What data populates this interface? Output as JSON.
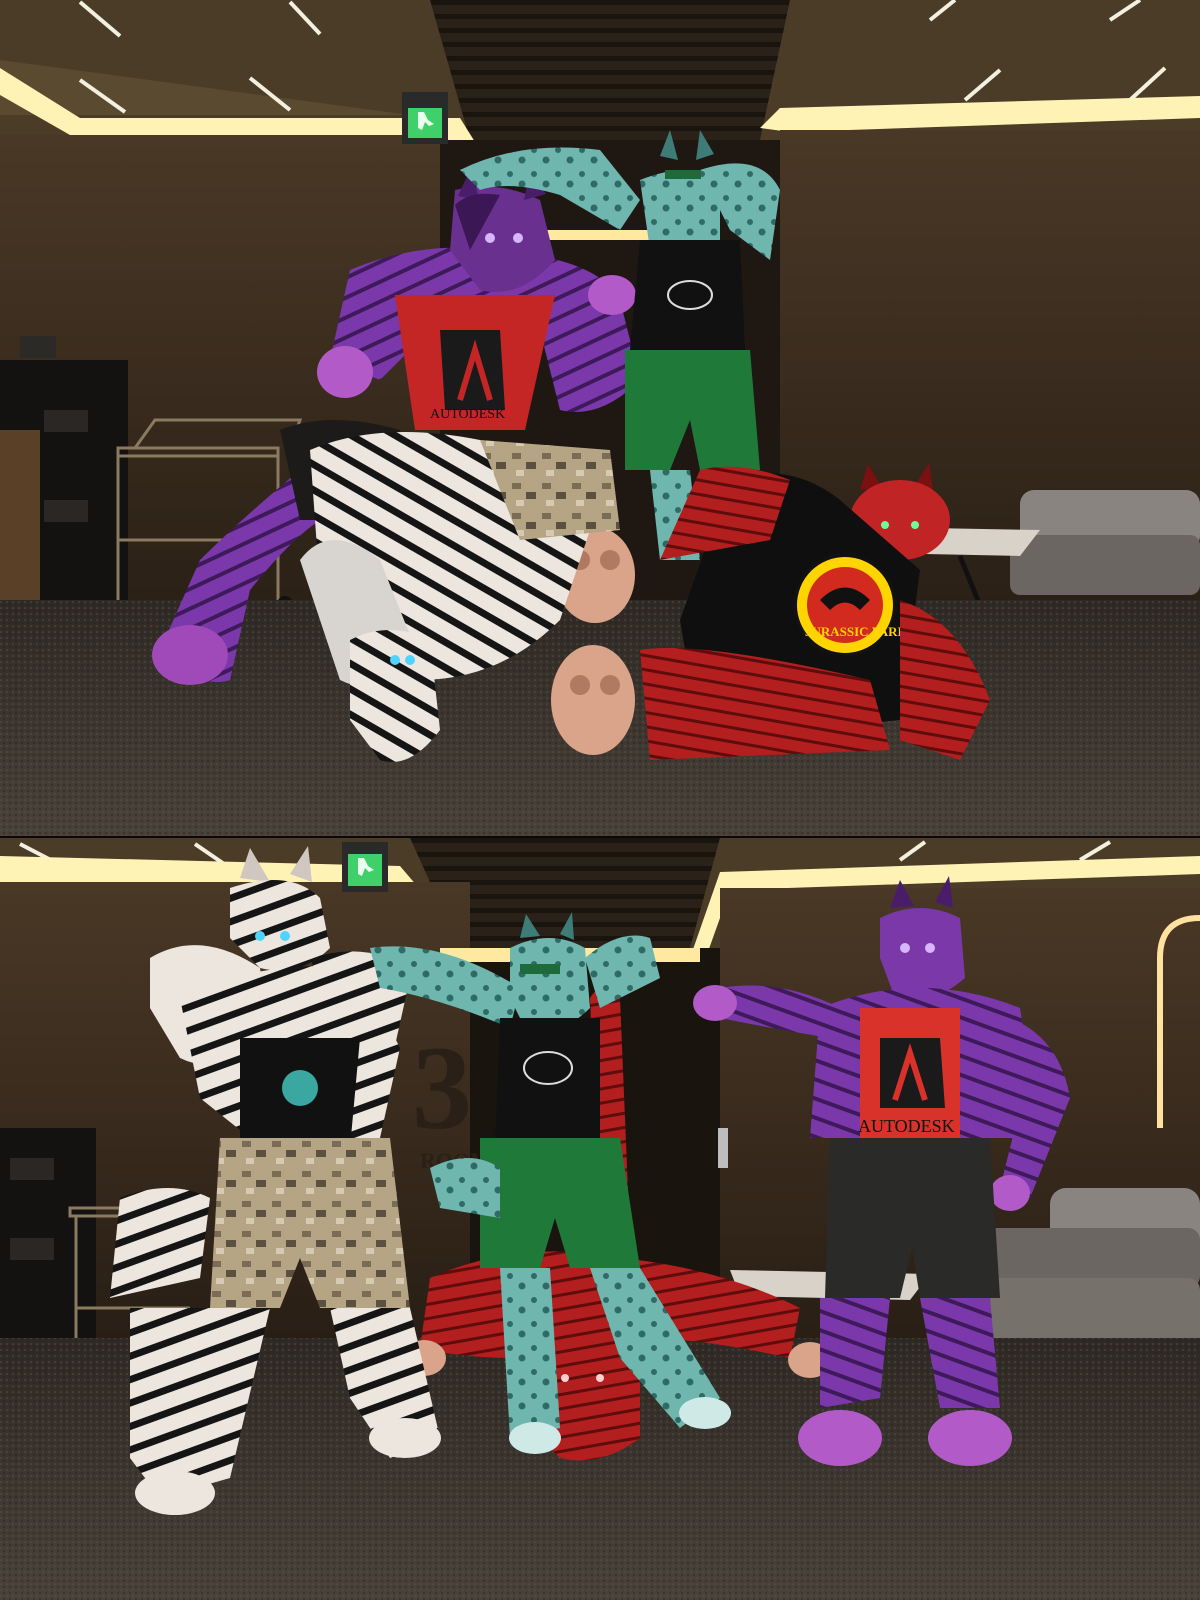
{
  "screenshots": [
    {
      "shirt_texts": [
        "AUTODESK",
        "JURASSIC PARK"
      ]
    },
    {
      "shirt_texts": [
        "AUTODESK"
      ],
      "wall_text": "3",
      "wall_subtext": "ROOMS"
    }
  ],
  "colors": {
    "ceiling": "#3b3020",
    "cove_light": "#fff1b0",
    "wall": "#3a2c1f",
    "carpet": "#3d362f",
    "exit_sign": "#3fd06a",
    "purple_fur": "#7a38a8",
    "teal_fur": "#6fb7b0",
    "red_fur": "#b82020",
    "zebra_fur": "#e8e2dc",
    "green_shorts": "#1f7a3a",
    "camo": "#b8a98a"
  },
  "icons": [
    "emergency-exit-sign-icon",
    "autodesk-logo",
    "jurassic-park-logo"
  ]
}
